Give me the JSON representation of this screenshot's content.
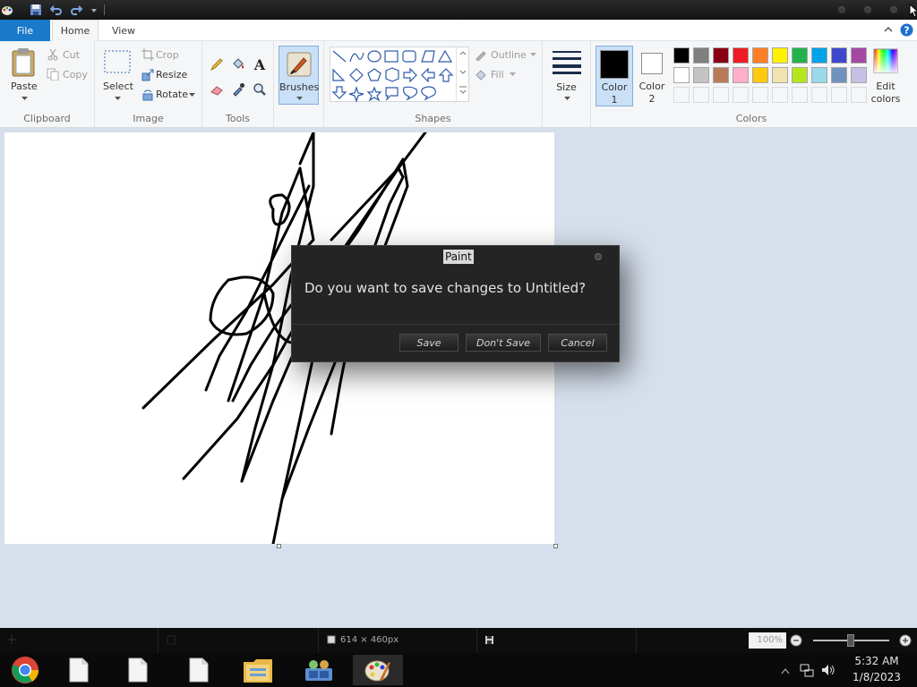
{
  "ribbon": {
    "tabs": {
      "file": "File",
      "home": "Home",
      "view": "View"
    },
    "clipboard": {
      "paste": "Paste",
      "cut": "Cut",
      "copy": "Copy",
      "label": "Clipboard"
    },
    "image": {
      "select": "Select",
      "crop": "Crop",
      "resize": "Resize",
      "rotate": "Rotate",
      "label": "Image"
    },
    "tools": {
      "label": "Tools"
    },
    "brushes": {
      "label": "Brushes"
    },
    "shapes": {
      "outline": "Outline",
      "fill": "Fill",
      "label": "Shapes"
    },
    "size": {
      "label": "Size"
    },
    "color1": {
      "line1": "Color",
      "line2": "1"
    },
    "color2": {
      "line1": "Color",
      "line2": "2"
    },
    "colors": {
      "label": "Colors",
      "edit_line1": "Edit",
      "edit_line2": "colors",
      "row1": [
        "#000000",
        "#7f7f7f",
        "#880015",
        "#ed1c24",
        "#ff7f27",
        "#fff200",
        "#22b14c",
        "#00a2e8",
        "#3f48cc",
        "#a349a4"
      ],
      "row2": [
        "#ffffff",
        "#c3c3c3",
        "#b97a57",
        "#ffaec9",
        "#ffc90e",
        "#efe4b0",
        "#b5e61d",
        "#99d9ea",
        "#7092be",
        "#c8bfe7"
      ],
      "color1_value": "#000000",
      "color2_value": "#ffffff"
    }
  },
  "dialog": {
    "title": "Paint",
    "message": "Do you want to save changes to Untitled?",
    "save": "Save",
    "dont_save": "Don't Save",
    "cancel": "Cancel"
  },
  "statusbar": {
    "canvas_size": "614 × 460px",
    "zoom": "100%"
  },
  "taskbar": {
    "time": "5:32 AM",
    "date": "1/8/2023"
  }
}
